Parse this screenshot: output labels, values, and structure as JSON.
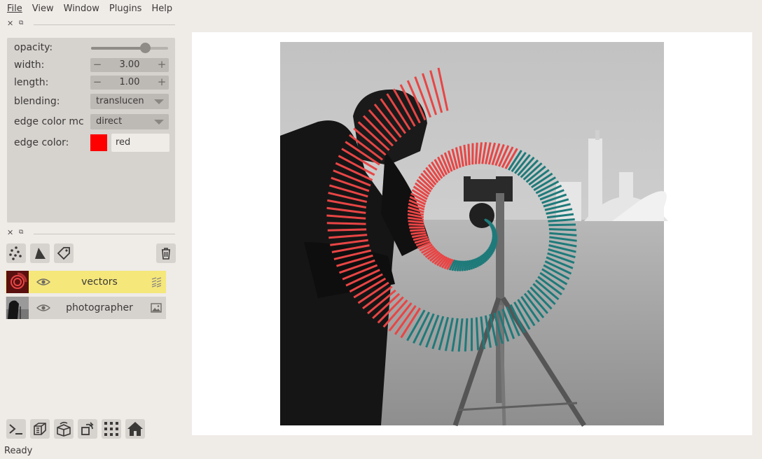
{
  "menu": [
    "File",
    "View",
    "Window",
    "Plugins",
    "Help"
  ],
  "layer_controls": {
    "opacity_label": "opacity:",
    "opacity_value": 0.7,
    "width_label": "width:",
    "width_value": "3.00",
    "length_label": "length:",
    "length_value": "1.00",
    "blending_label": "blending:",
    "blending_value": "translucen",
    "edge_color_mode_label": "edge color mc",
    "edge_color_mode_value": "direct",
    "edge_color_label": "edge color:",
    "edge_color_value": "red",
    "edge_color_swatch": "#ff0000"
  },
  "layer_buttons": [
    "points-icon",
    "shapes-icon",
    "labels-icon",
    "delete-icon"
  ],
  "layers": [
    {
      "name": "vectors",
      "selected": true,
      "visible": true,
      "type_icon": "vectors-icon"
    },
    {
      "name": "photographer",
      "selected": false,
      "visible": true,
      "type_icon": "image-icon"
    }
  ],
  "viewer_buttons": [
    "console-icon",
    "ndisplay-icon",
    "roll-icon",
    "transpose-icon",
    "grid-icon",
    "home-icon"
  ],
  "colors": {
    "selected_layer": "#f5e77a",
    "panel": "#d6d2ce",
    "background": "#efebe7",
    "vector_red": "#e84545",
    "vector_teal": "#1f7a7a"
  },
  "status": "Ready"
}
